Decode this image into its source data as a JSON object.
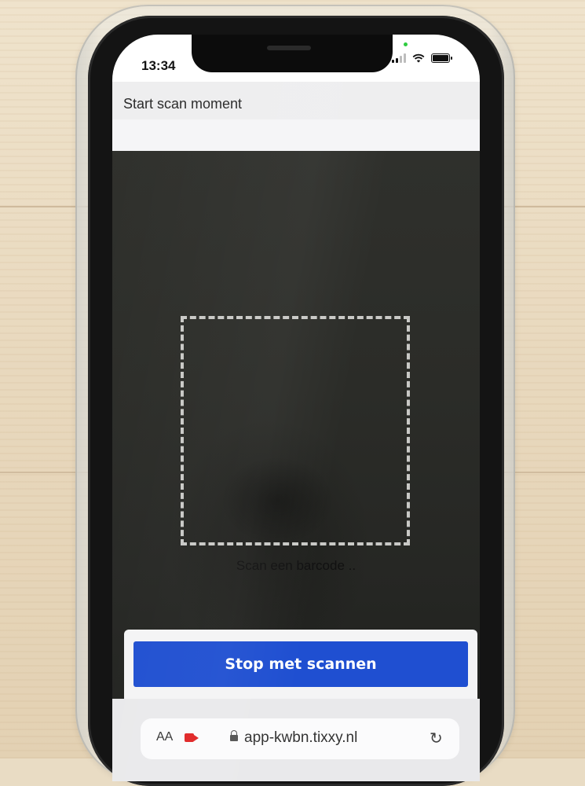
{
  "status_bar": {
    "time": "13:34"
  },
  "page": {
    "title": "Start scan moment"
  },
  "scanner": {
    "hint": "Scan een barcode .."
  },
  "actions": {
    "stop_label": "Stop met scannen"
  },
  "browser": {
    "text_size_label": "AA",
    "url": "app-kwbn.tixxy.nl",
    "reload_glyph": "↻"
  },
  "colors": {
    "primary_button": "#1f4fd1",
    "camera_indicator": "#e02424"
  },
  "icons": [
    "signal-icon",
    "wifi-icon",
    "battery-icon",
    "camera-indicator-icon",
    "lock-icon",
    "reload-icon"
  ]
}
